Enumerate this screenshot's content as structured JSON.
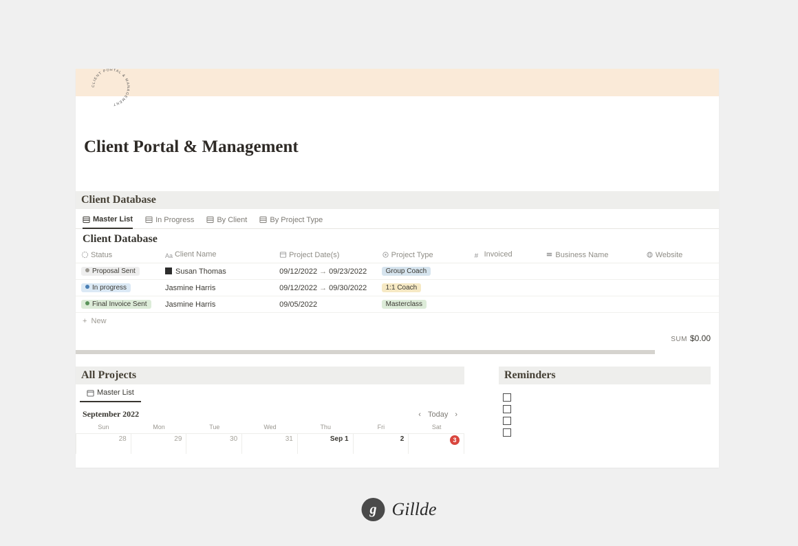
{
  "logo_text": "CLIENT PORTAL & MANAGEMENT",
  "page_title": "Client Portal & Management",
  "client_db": {
    "section_label": "Client Database",
    "tabs": [
      "Master List",
      "In Progress",
      "By Client",
      "By Project Type"
    ],
    "table_title": "Client Database",
    "columns": [
      "Status",
      "Client Name",
      "Project Date(s)",
      "Project Type",
      "Invoiced",
      "Business Name",
      "Website"
    ],
    "rows": [
      {
        "status": {
          "label": "Proposal Sent",
          "bg": "#eeeeee",
          "dot": "#9a9790"
        },
        "client": "Susan Thomas",
        "has_page_icon": true,
        "date_from": "09/12/2022",
        "date_to": "09/23/2022",
        "type": {
          "label": "Group Coach",
          "bg": "#d6e4ee"
        }
      },
      {
        "status": {
          "label": "In progress",
          "bg": "#dbe9f5",
          "dot": "#4a7fb5"
        },
        "client": "Jasmine Harris",
        "has_page_icon": false,
        "date_from": "09/12/2022",
        "date_to": "09/30/2022",
        "type": {
          "label": "1:1 Coach",
          "bg": "#f6e9c4"
        }
      },
      {
        "status": {
          "label": "Final Invoice Sent",
          "bg": "#ddecd9",
          "dot": "#5a935a"
        },
        "client": "Jasmine Harris",
        "has_page_icon": false,
        "date_from": "09/05/2022",
        "date_to": null,
        "type": {
          "label": "Masterclass",
          "bg": "#ddecd9"
        }
      }
    ],
    "new_label": "New",
    "sum_label": "SUM",
    "sum_value": "$0.00"
  },
  "projects": {
    "section_label": "All Projects",
    "view_tab": "Master List",
    "month_label": "September 2022",
    "today_label": "Today",
    "dows": [
      "Sun",
      "Mon",
      "Tue",
      "Wed",
      "Thu",
      "Fri",
      "Sat"
    ],
    "days": [
      {
        "n": "28",
        "cur": false
      },
      {
        "n": "29",
        "cur": false
      },
      {
        "n": "30",
        "cur": false
      },
      {
        "n": "31",
        "cur": false
      },
      {
        "n": "Sep 1",
        "cur": true
      },
      {
        "n": "2",
        "cur": true
      },
      {
        "n": "3",
        "cur": true,
        "badge": true
      }
    ]
  },
  "reminders": {
    "section_label": "Reminders",
    "count": 4
  },
  "watermark": {
    "initial": "g",
    "name": "Gillde"
  }
}
